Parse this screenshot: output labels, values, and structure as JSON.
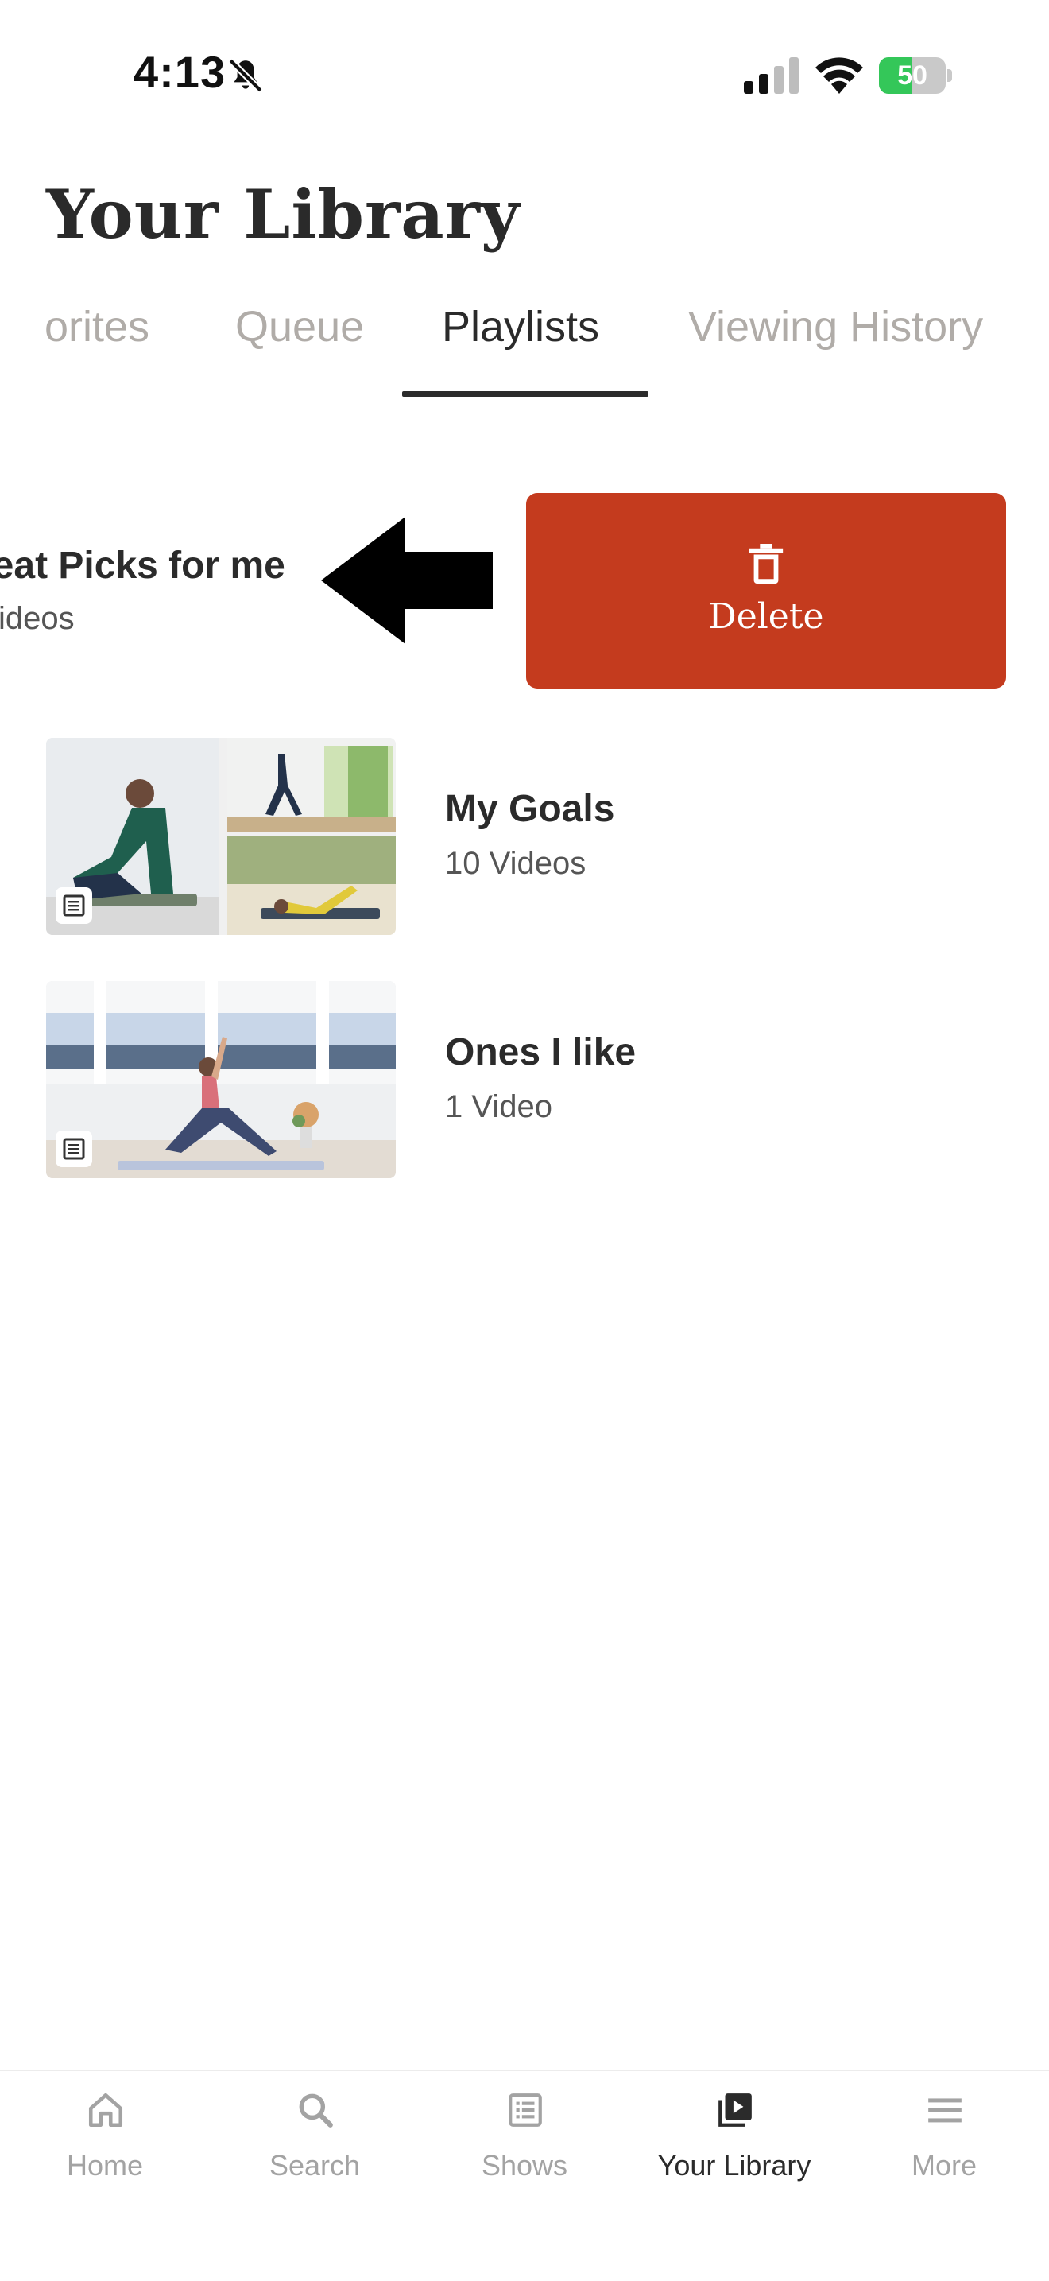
{
  "status_bar": {
    "time": "4:13",
    "battery": "50",
    "battery_level_percent": 50,
    "icons": [
      "bell-off-icon",
      "signal-icon",
      "wifi-icon",
      "battery-icon"
    ]
  },
  "header": {
    "title": "Your Library"
  },
  "tabs": [
    {
      "label": "orites",
      "active": false
    },
    {
      "label": "Queue",
      "active": false
    },
    {
      "label": "Playlists",
      "active": true
    },
    {
      "label": "Viewing History",
      "active": false
    }
  ],
  "swiped_row": {
    "title": "reat Picks for me",
    "subtitle": "Videos",
    "delete_label": "Delete",
    "delete_color": "#c43b1e"
  },
  "playlists": [
    {
      "title": "My Goals",
      "subtitle": "10 Videos"
    },
    {
      "title": "Ones I like",
      "subtitle": "1 Video"
    }
  ],
  "bottom_nav": [
    {
      "label": "Home",
      "icon": "home-icon",
      "active": false
    },
    {
      "label": "Search",
      "icon": "search-icon",
      "active": false
    },
    {
      "label": "Shows",
      "icon": "shows-icon",
      "active": false
    },
    {
      "label": "Your Library",
      "icon": "library-icon",
      "active": true
    },
    {
      "label": "More",
      "icon": "menu-icon",
      "active": false
    }
  ],
  "colors": {
    "text_primary": "#2b2b2b",
    "tab_inactive": "#b0aca8",
    "delete": "#c43b1e",
    "battery": "#34c759"
  }
}
